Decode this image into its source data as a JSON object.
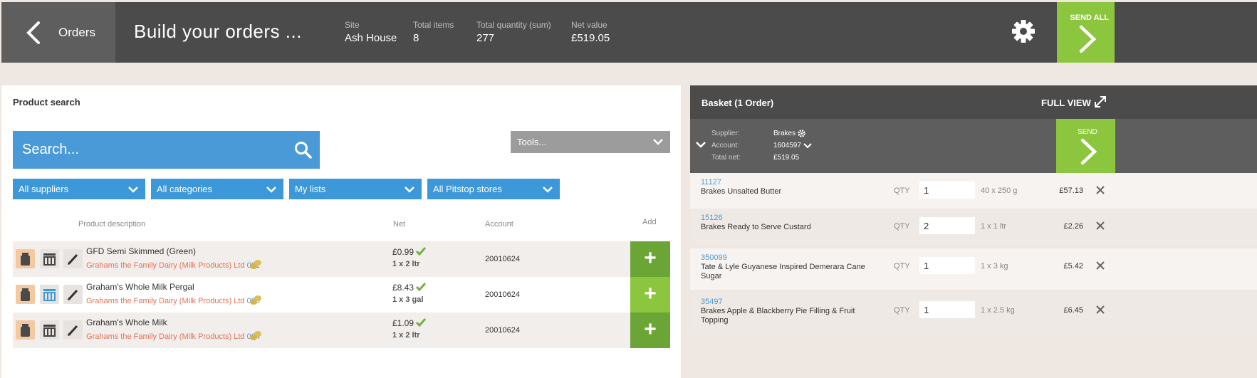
{
  "header": {
    "back_label": "Orders",
    "title": "Build your orders ...",
    "stats": [
      {
        "label": "Site",
        "value": "Ash House"
      },
      {
        "label": "Total items",
        "value": "8"
      },
      {
        "label": "Total quantity (sum)",
        "value": "277"
      },
      {
        "label": "Net value",
        "value": "£519.05"
      }
    ],
    "send_all_label": "SEND ALL"
  },
  "search_panel": {
    "title": "Product search",
    "search_placeholder": "Search...",
    "tools_label": "Tools...",
    "filters": [
      "All suppliers",
      "All categories",
      "My lists",
      "All Pitstop stores"
    ],
    "columns": {
      "description": "Product description",
      "net": "Net",
      "account": "Account",
      "add": "Add"
    },
    "products": [
      {
        "name": "GFD Semi Skimmed (Green)",
        "supplier": "Grahams the Family Dairy (Milk Products) Ltd",
        "code": "001",
        "net": "£0.99",
        "pack": "1 x 2 ltr",
        "account": "20010624"
      },
      {
        "name": "Graham's Whole Milk Pergal",
        "supplier": "Grahams the Family Dairy (Milk Products) Ltd",
        "code": "003",
        "net": "£8.43",
        "pack": "1 x 3 gal",
        "account": "20010624"
      },
      {
        "name": "Graham's Whole Milk",
        "supplier": "Grahams the Family Dairy (Milk Products) Ltd",
        "code": "004",
        "net": "£1.09",
        "pack": "1 x 2 ltr",
        "account": "20010624"
      }
    ]
  },
  "basket": {
    "title": "Basket (1 Order)",
    "full_view_label": "FULL VIEW",
    "supplier_label": "Supplier:",
    "supplier_value": "Brakes",
    "account_label": "Account:",
    "account_value": "1604597",
    "total_label": "Total net:",
    "total_value": "£519.05",
    "send_label": "SEND",
    "qty_label": "QTY",
    "lines": [
      {
        "code": "11127",
        "name": "Brakes Unsalted Butter",
        "qty": "1",
        "pack": "40 x 250 g",
        "price": "£57.13"
      },
      {
        "code": "15126",
        "name": "Brakes Ready to Serve Custard",
        "qty": "2",
        "pack": "1 x 1 ltr",
        "price": "£2.26"
      },
      {
        "code": "350099",
        "name": "Tate & Lyle Guyanese Inspired Demerara Cane Sugar",
        "qty": "1",
        "pack": "1 x 3 kg",
        "price": "£5.42"
      },
      {
        "code": "35497",
        "name": "Brakes Apple & Blackberry Pie Filling & Fruit Topping",
        "qty": "1",
        "pack": "1 x 2.5 kg",
        "price": "£6.45"
      }
    ]
  },
  "colors": {
    "header": "#4b4b4b",
    "accent_green": "#8cc63f",
    "accent_blue": "#4a9ad8",
    "supplier_text": "#e0735a"
  }
}
